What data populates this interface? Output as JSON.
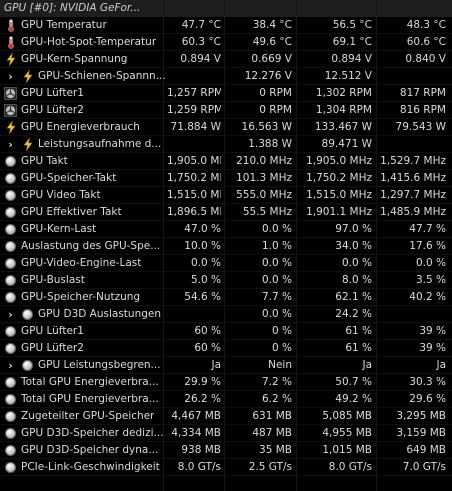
{
  "header": {
    "title": "GPU [#0]: NVIDIA GeFor..."
  },
  "rows": [
    {
      "label": "GPU Temperatur",
      "icon": "thermometer-icon",
      "indent": 0,
      "chevron": false,
      "values": [
        "47.7 °C",
        "38.4 °C",
        "56.5 °C",
        "48.3 °C"
      ]
    },
    {
      "label": "GPU-Hot-Spot-Temperatur",
      "icon": "thermometer-icon",
      "indent": 0,
      "chevron": false,
      "values": [
        "60.3 °C",
        "49.6 °C",
        "69.1 °C",
        "60.6 °C"
      ]
    },
    {
      "label": "GPU-Kern-Spannung",
      "icon": "lightning-icon",
      "indent": 0,
      "chevron": false,
      "values": [
        "0.894 V",
        "0.669 V",
        "0.894 V",
        "0.840 V"
      ]
    },
    {
      "label": "GPU-Schienen-Spannn...",
      "icon": "lightning-icon",
      "indent": 1,
      "chevron": true,
      "values": [
        "",
        "12.276 V",
        "12.512 V",
        ""
      ]
    },
    {
      "label": "GPU Lüfter1",
      "icon": "fan-icon",
      "indent": 0,
      "chevron": false,
      "values": [
        "1,257 RPM",
        "0 RPM",
        "1,302 RPM",
        "817 RPM"
      ]
    },
    {
      "label": "GPU Lüfter2",
      "icon": "fan-icon",
      "indent": 0,
      "chevron": false,
      "values": [
        "1,259 RPM",
        "0 RPM",
        "1,304 RPM",
        "816 RPM"
      ]
    },
    {
      "label": "GPU Energieverbrauch",
      "icon": "lightning-icon",
      "indent": 0,
      "chevron": false,
      "values": [
        "71.884 W",
        "16.563 W",
        "133.467 W",
        "79.543 W"
      ]
    },
    {
      "label": "Leistungsaufnahme d...",
      "icon": "lightning-icon",
      "indent": 1,
      "chevron": true,
      "values": [
        "",
        "1.388 W",
        "89.471 W",
        ""
      ]
    },
    {
      "label": "GPU Takt",
      "icon": "clock-icon",
      "indent": 0,
      "chevron": false,
      "values": [
        "1,905.0 MHz",
        "210.0 MHz",
        "1,905.0 MHz",
        "1,529.7 MHz"
      ]
    },
    {
      "label": "GPU-Speicher-Takt",
      "icon": "clock-icon",
      "indent": 0,
      "chevron": false,
      "values": [
        "1,750.2 MHz",
        "101.3 MHz",
        "1,750.2 MHz",
        "1,415.6 MHz"
      ]
    },
    {
      "label": "GPU Video Takt",
      "icon": "clock-icon",
      "indent": 0,
      "chevron": false,
      "values": [
        "1,515.0 MHz",
        "555.0 MHz",
        "1,515.0 MHz",
        "1,297.7 MHz"
      ]
    },
    {
      "label": "GPU Effektiver Takt",
      "icon": "clock-icon",
      "indent": 0,
      "chevron": false,
      "values": [
        "1,896.5 MHz",
        "55.5 MHz",
        "1,901.1 MHz",
        "1,485.9 MHz"
      ]
    },
    {
      "label": "GPU-Kern-Last",
      "icon": "clock-icon",
      "indent": 0,
      "chevron": false,
      "values": [
        "47.0 %",
        "0.0 %",
        "97.0 %",
        "47.7 %"
      ]
    },
    {
      "label": "Auslastung des GPU-Spe...",
      "icon": "clock-icon",
      "indent": 0,
      "chevron": false,
      "values": [
        "10.0 %",
        "1.0 %",
        "34.0 %",
        "17.6 %"
      ]
    },
    {
      "label": "GPU-Video-Engine-Last",
      "icon": "clock-icon",
      "indent": 0,
      "chevron": false,
      "values": [
        "0.0 %",
        "0.0 %",
        "0.0 %",
        "0.0 %"
      ]
    },
    {
      "label": "GPU-Buslast",
      "icon": "clock-icon",
      "indent": 0,
      "chevron": false,
      "values": [
        "5.0 %",
        "0.0 %",
        "8.0 %",
        "3.5 %"
      ]
    },
    {
      "label": "GPU-Speicher-Nutzung",
      "icon": "clock-icon",
      "indent": 0,
      "chevron": false,
      "values": [
        "54.6 %",
        "7.7 %",
        "62.1 %",
        "40.2 %"
      ]
    },
    {
      "label": "GPU D3D Auslastungen",
      "icon": "clock-icon",
      "indent": 1,
      "chevron": true,
      "values": [
        "",
        "0.0 %",
        "24.2 %",
        ""
      ]
    },
    {
      "label": "GPU Lüfter1",
      "icon": "clock-icon",
      "indent": 0,
      "chevron": false,
      "values": [
        "60 %",
        "0 %",
        "61 %",
        "39 %"
      ]
    },
    {
      "label": "GPU Lüfter2",
      "icon": "clock-icon",
      "indent": 0,
      "chevron": false,
      "values": [
        "60 %",
        "0 %",
        "61 %",
        "39 %"
      ]
    },
    {
      "label": "GPU Leistungsbegren...",
      "icon": "clock-icon",
      "indent": 1,
      "chevron": true,
      "values": [
        "Ja",
        "Nein",
        "Ja",
        "Ja"
      ]
    },
    {
      "label": "Total GPU Energieverbra...",
      "icon": "clock-icon",
      "indent": 0,
      "chevron": false,
      "values": [
        "29.9 %",
        "7.2 %",
        "50.7 %",
        "30.3 %"
      ]
    },
    {
      "label": "Total GPU Energieverbra...",
      "icon": "clock-icon",
      "indent": 0,
      "chevron": false,
      "values": [
        "26.2 %",
        "6.2 %",
        "49.2 %",
        "29.6 %"
      ]
    },
    {
      "label": "Zugeteilter GPU-Speicher",
      "icon": "clock-icon",
      "indent": 0,
      "chevron": false,
      "values": [
        "4,467 MB",
        "631 MB",
        "5,085 MB",
        "3,295 MB"
      ]
    },
    {
      "label": "GPU D3D-Speicher dedizi...",
      "icon": "clock-icon",
      "indent": 0,
      "chevron": false,
      "values": [
        "4,334 MB",
        "487 MB",
        "4,955 MB",
        "3,159 MB"
      ]
    },
    {
      "label": "GPU D3D-Speicher dyna...",
      "icon": "clock-icon",
      "indent": 0,
      "chevron": false,
      "values": [
        "938 MB",
        "35 MB",
        "1,015 MB",
        "649 MB"
      ]
    },
    {
      "label": "PCIe-Link-Geschwindigkeit",
      "icon": "clock-icon",
      "indent": 0,
      "chevron": false,
      "values": [
        "8.0 GT/s",
        "2.5 GT/s",
        "8.0 GT/s",
        "7.0 GT/s"
      ]
    }
  ]
}
